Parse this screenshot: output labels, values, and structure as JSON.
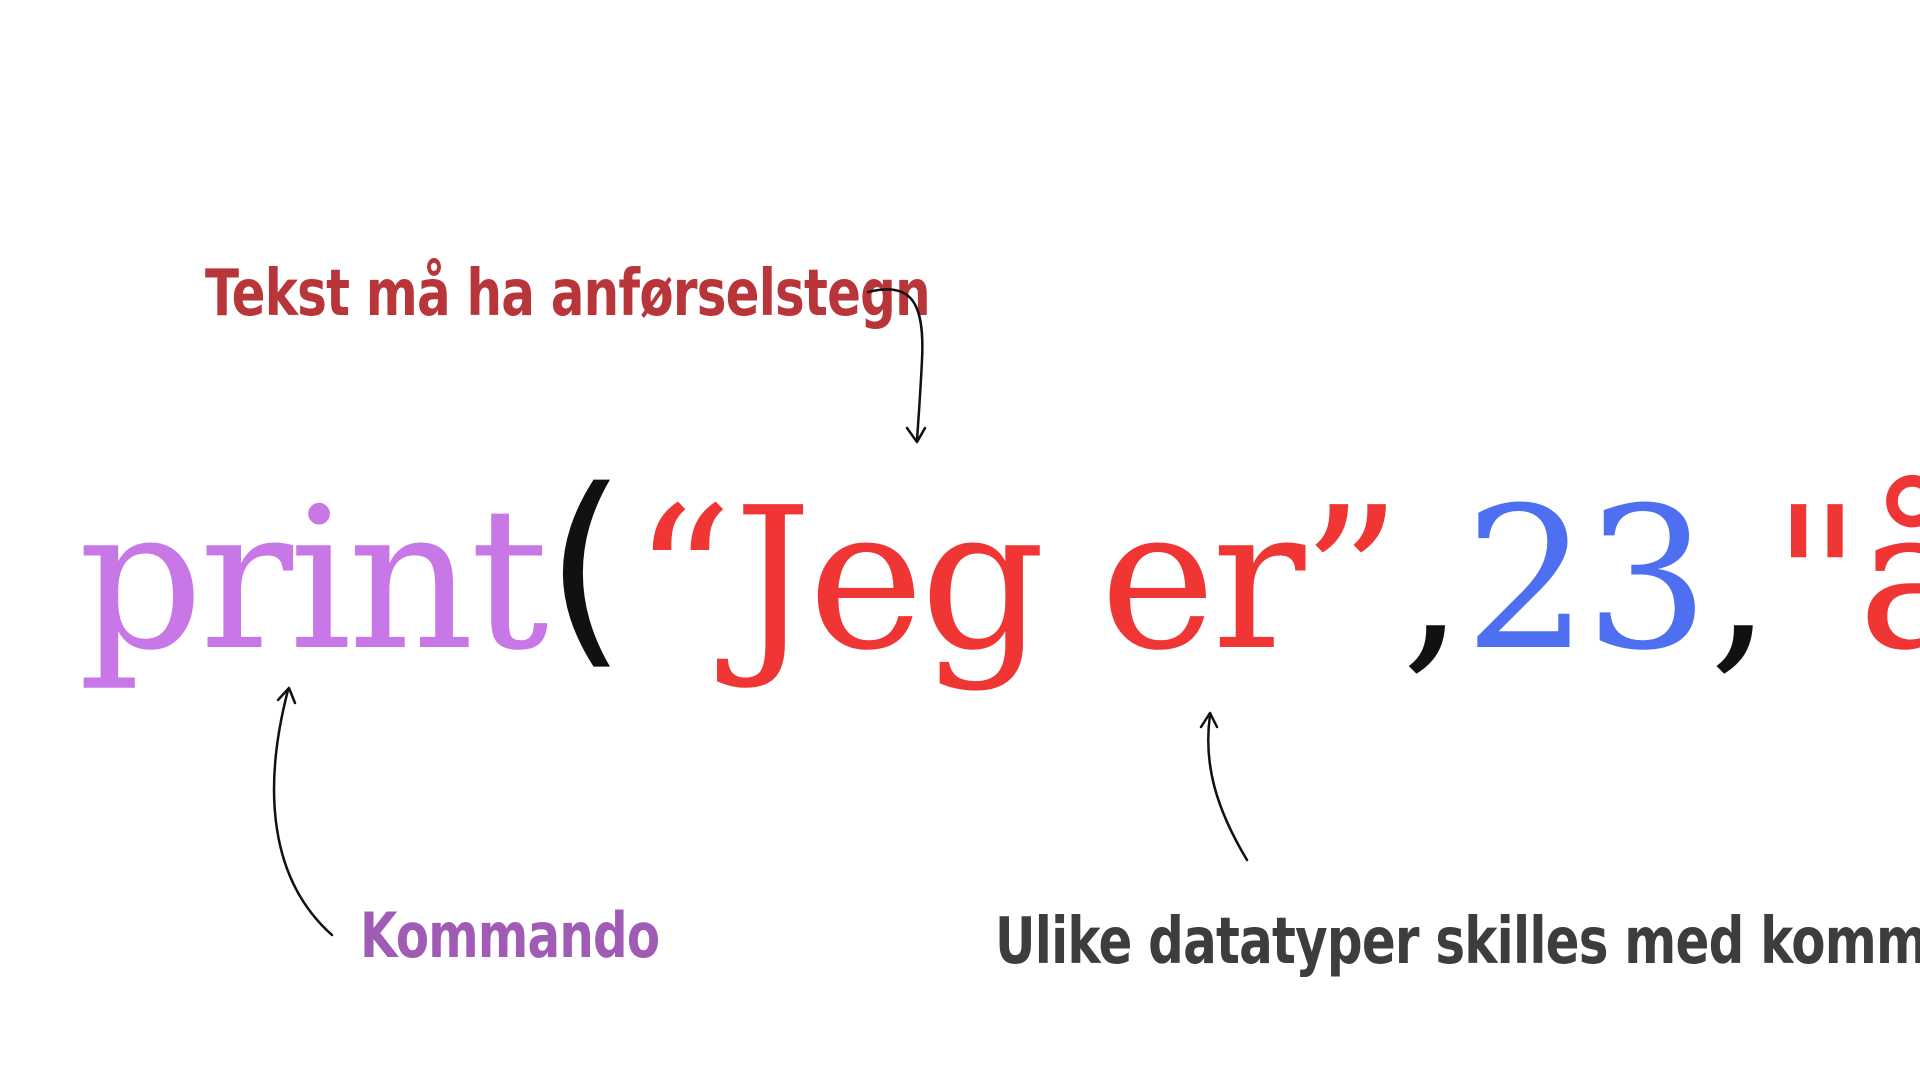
{
  "annotations": {
    "text_rule": "Tekst må ha anførselstegn",
    "command": "Kommando",
    "types_rule": "Ulike datatyper skilles med kommategn"
  },
  "code": {
    "command": "print",
    "paren_open": "(",
    "string1": "“Jeg er”",
    "comma1": ",",
    "number": "23",
    "comma2": ",",
    "string2": "\"år\"",
    "paren_close": ")"
  },
  "colors": {
    "command": "#c777e6",
    "string": "#f03535",
    "number": "#4d6ff0",
    "punctuation": "#111111",
    "annotation_text_rule": "#b8353a",
    "annotation_command": "#a05cb5",
    "annotation_types_rule": "#3d3d3d"
  }
}
